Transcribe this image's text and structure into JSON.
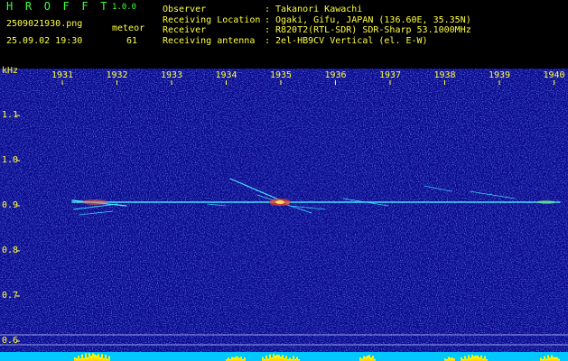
{
  "app": {
    "name": "H R O F F T",
    "version": "1.0.0"
  },
  "file_name": "2509021930.png",
  "timestamp": "25.09.02 19:30",
  "meteor": {
    "label": "meteor",
    "count": "61"
  },
  "info": [
    {
      "label": "Observer",
      "value": "Takanori Kawachi"
    },
    {
      "label": "Receiving Location",
      "value": "Ogaki, Gifu, JAPAN (136.60E, 35.35N)"
    },
    {
      "label": "Receiver",
      "value": "R820T2(RTL-SDR) SDR-Sharp 53.1000MHz"
    },
    {
      "label": "Receiving antenna",
      "value": "2el-HB9CV Vertical (el. E-W)"
    }
  ],
  "separator": ":",
  "axis": {
    "unit": "kHz",
    "minutes": [
      "1931",
      "1932",
      "1933",
      "1934",
      "1935",
      "1936",
      "1937",
      "1938",
      "1939",
      "1940"
    ],
    "freq_ticks": [
      "1.1",
      "1.0",
      "0.9",
      "0.8",
      "0.7",
      "0.6"
    ]
  },
  "colors": {
    "background": "#000000",
    "spectrogram_base": "#0a0a8c",
    "label_yellow": "#ffff40",
    "title_green": "#3cff3c",
    "signal_cyan": "#40e0ff",
    "audio_level": "#ffff00"
  }
}
